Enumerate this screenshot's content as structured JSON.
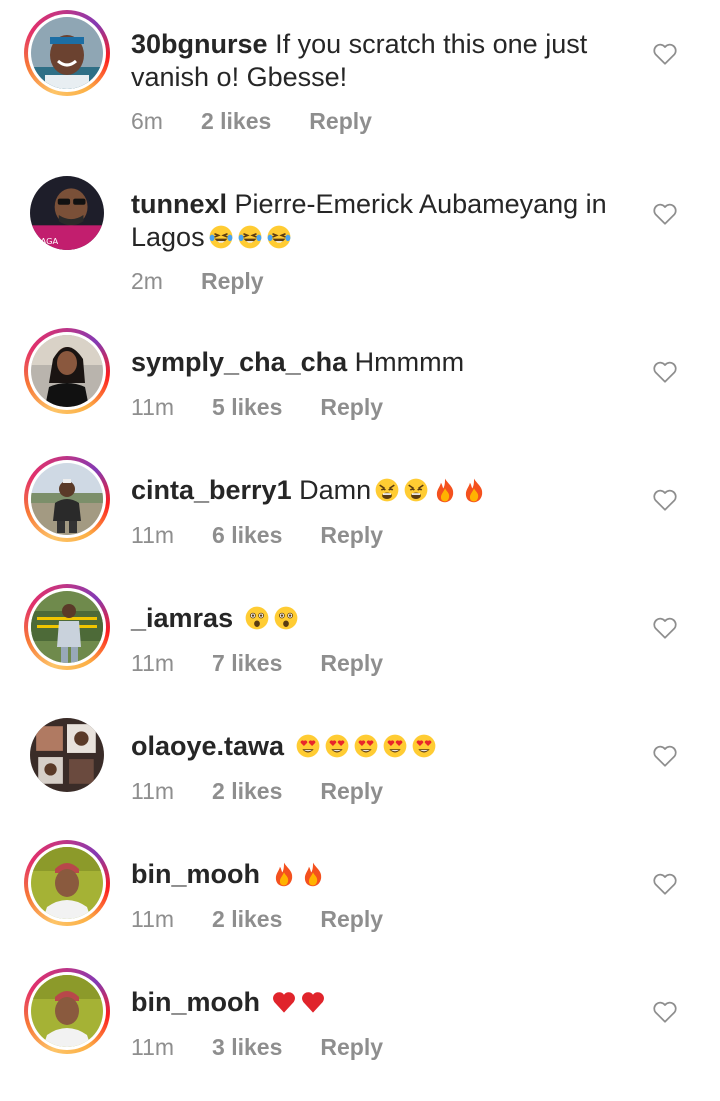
{
  "comments": [
    {
      "username": "30bgnurse",
      "text": "If you scratch this one just vanish o! Gbesse!",
      "emojis": [],
      "time": "6m",
      "likes": "2 likes",
      "reply": "Reply",
      "story_ring": true,
      "avatar_icon": "avatar-man-headband-icon"
    },
    {
      "username": "tunnexl",
      "text": "Pierre-Emerick Aubameyang in Lagos",
      "emojis": [
        "laughing-tears-emoji",
        "laughing-tears-emoji",
        "laughing-tears-emoji"
      ],
      "time": "2m",
      "likes": "",
      "reply": "Reply",
      "story_ring": false,
      "avatar_icon": "avatar-man-sunglasses-icon"
    },
    {
      "username": "symply_cha_cha",
      "text": "Hmmmm",
      "emojis": [],
      "time": "11m",
      "likes": "5 likes",
      "reply": "Reply",
      "story_ring": true,
      "avatar_icon": "avatar-woman-icon"
    },
    {
      "username": "cinta_berry1",
      "text": "Damn",
      "emojis": [
        "weary-face-emoji",
        "weary-face-emoji",
        "fire-emoji",
        "fire-emoji"
      ],
      "time": "11m",
      "likes": "6 likes",
      "reply": "Reply",
      "story_ring": true,
      "avatar_icon": "avatar-person-outdoor-icon"
    },
    {
      "username": "_iamras",
      "text": "",
      "emojis": [
        "astonished-face-emoji",
        "astonished-face-emoji"
      ],
      "time": "11m",
      "likes": "7 likes",
      "reply": "Reply",
      "story_ring": true,
      "avatar_icon": "avatar-man-standing-icon"
    },
    {
      "username": "olaoye.tawa",
      "text": "",
      "emojis": [
        "heart-eyes-emoji",
        "heart-eyes-emoji",
        "heart-eyes-emoji",
        "heart-eyes-emoji",
        "heart-eyes-emoji"
      ],
      "time": "11m",
      "likes": "2 likes",
      "reply": "Reply",
      "story_ring": false,
      "avatar_icon": "avatar-collage-icon"
    },
    {
      "username": "bin_mooh",
      "text": "",
      "emojis": [
        "fire-emoji",
        "fire-emoji"
      ],
      "time": "11m",
      "likes": "2 likes",
      "reply": "Reply",
      "story_ring": true,
      "avatar_icon": "avatar-man-cap-icon"
    },
    {
      "username": "bin_mooh",
      "text": "",
      "emojis": [
        "red-heart-emoji",
        "red-heart-emoji"
      ],
      "time": "11m",
      "likes": "3 likes",
      "reply": "Reply",
      "story_ring": true,
      "avatar_icon": "avatar-man-cap-icon"
    }
  ],
  "colors": {
    "text": "#262626",
    "meta": "#8e8e8e",
    "heart_outline": "#8e8e8e"
  }
}
